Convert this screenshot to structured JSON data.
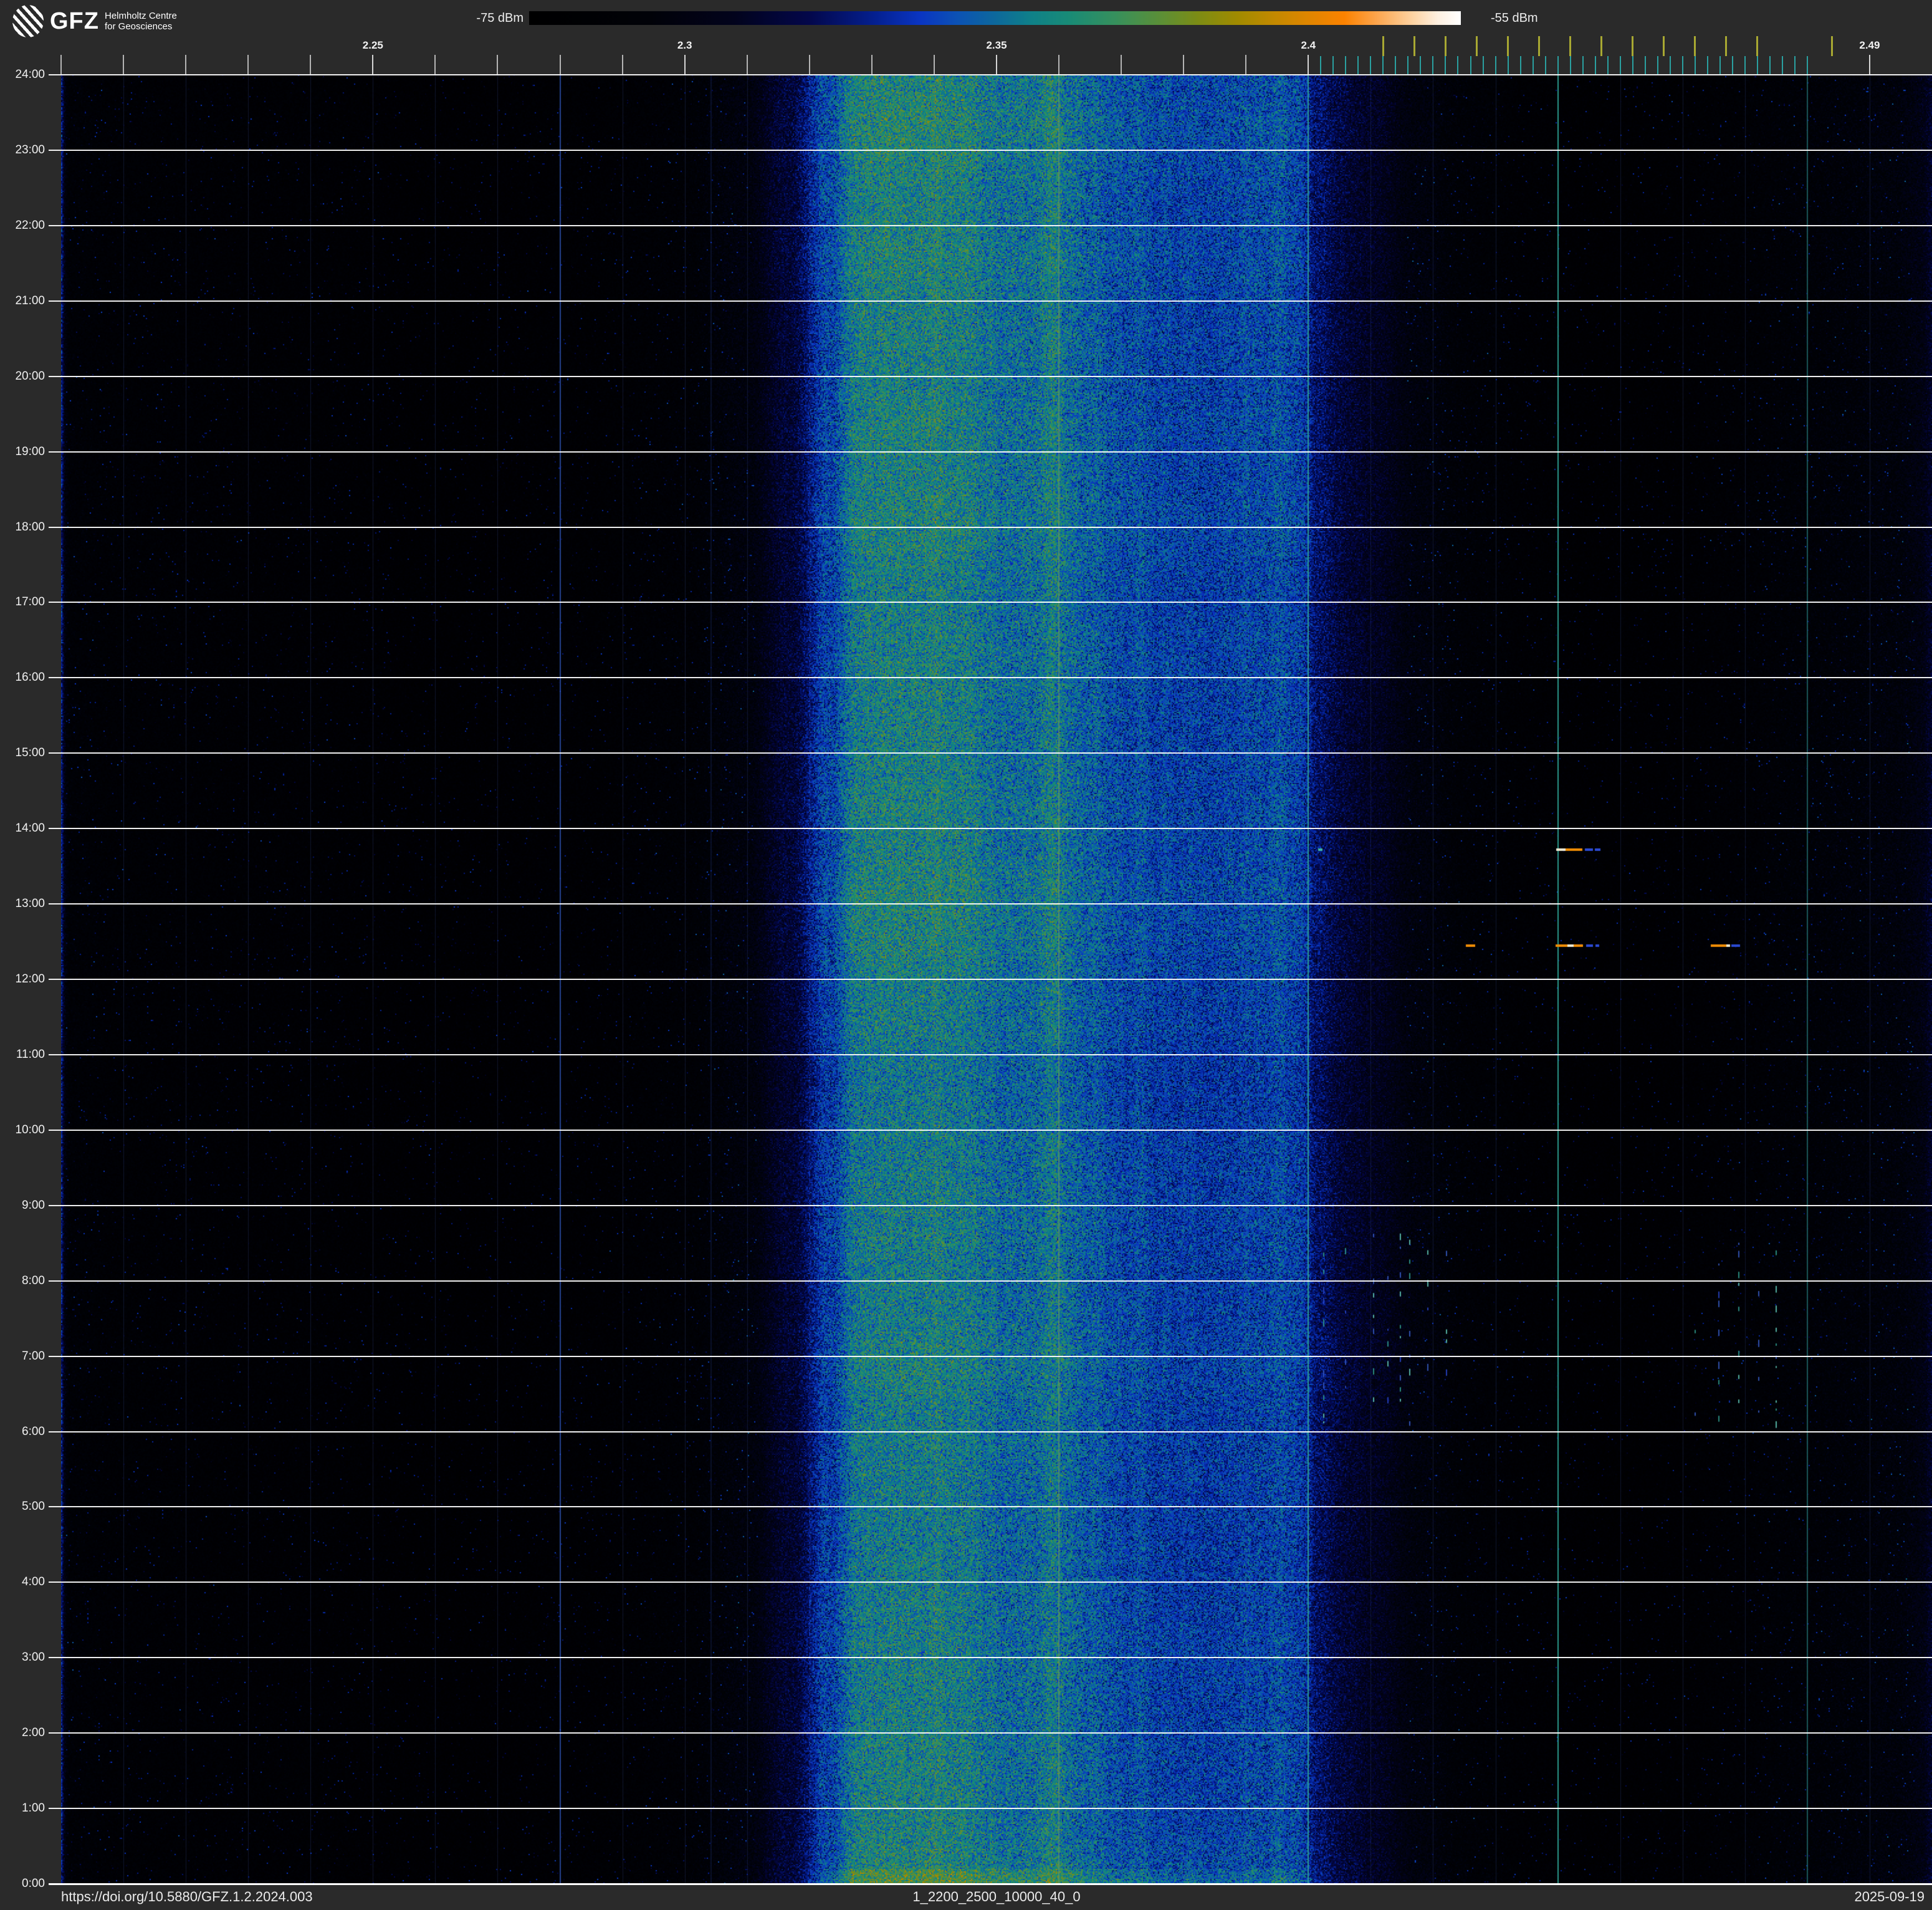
{
  "background": "#2a2a2a",
  "header": {
    "logo": {
      "brand": "GFZ",
      "line1": "Helmholtz Centre",
      "line2": "for Geosciences"
    },
    "colorbar": {
      "min_label": "-75 dBm",
      "max_label": "-55 dBm",
      "stops": [
        [
          0.0,
          "#000000"
        ],
        [
          0.13,
          "#010208"
        ],
        [
          0.22,
          "#02031c"
        ],
        [
          0.3,
          "#03074a"
        ],
        [
          0.37,
          "#041f8e"
        ],
        [
          0.42,
          "#0a35c2"
        ],
        [
          0.46,
          "#0c52b4"
        ],
        [
          0.5,
          "#0d689c"
        ],
        [
          0.54,
          "#0f8188"
        ],
        [
          0.58,
          "#198b76"
        ],
        [
          0.63,
          "#37905c"
        ],
        [
          0.68,
          "#5d8f35"
        ],
        [
          0.72,
          "#7e8c13"
        ],
        [
          0.76,
          "#a08a00"
        ],
        [
          0.8,
          "#c38900"
        ],
        [
          0.84,
          "#e28500"
        ],
        [
          0.875,
          "#fb8200"
        ],
        [
          0.91,
          "#fca54e"
        ],
        [
          0.945,
          "#fdcf9b"
        ],
        [
          0.975,
          "#fef0e0"
        ],
        [
          1.0,
          "#ffffff"
        ]
      ]
    }
  },
  "footer": {
    "doi": "https://doi.org/10.5880/GFZ.1.2.2024.003",
    "filename": "1_2200_2500_10000_40_0",
    "date": "2025-09-19"
  },
  "chart_data": {
    "type": "heatmap",
    "x_axis": {
      "unit": "GHz",
      "range": [
        2.2,
        2.5
      ],
      "tick_values": [
        2.25,
        2.3,
        2.35,
        2.4,
        2.49
      ],
      "tick_labels": [
        "2.25",
        "2.3",
        "2.35",
        "2.4",
        "2.49"
      ],
      "minor_tick_step": 0.01
    },
    "y_axis": {
      "unit": "time of day",
      "hour_labels": [
        "24:00",
        "23:00",
        "22:00",
        "21:00",
        "20:00",
        "19:00",
        "18:00",
        "17:00",
        "16:00",
        "15:00",
        "14:00",
        "13:00",
        "12:00",
        "11:00",
        "10:00",
        "9:00",
        "8:00",
        "7:00",
        "6:00",
        "5:00",
        "4:00",
        "3:00",
        "2:00",
        "1:00",
        "0:00"
      ]
    },
    "power_scale_dbm": [
      -75,
      -55
    ],
    "wifi_channel_ticks_mhz": [
      2412,
      2417,
      2422,
      2427,
      2432,
      2437,
      2442,
      2447,
      2452,
      2457,
      2462,
      2467,
      2472,
      2484
    ],
    "ble_channel_ticks_mhz": {
      "start": 2402,
      "end": 2480,
      "step": 2
    },
    "marker_lines": [
      {
        "ghz": 2.28,
        "color": "#3c6eeb",
        "alpha": 0.55,
        "w": 2
      },
      {
        "ghz": 2.3042,
        "color": "#3c6eeb",
        "alpha": 0.3,
        "w": 1
      },
      {
        "ghz": 2.36,
        "color": "#6e9b5a",
        "alpha": 0.6,
        "w": 2
      },
      {
        "ghz": 2.4,
        "color": "#2da596",
        "alpha": 0.9,
        "w": 2
      },
      {
        "ghz": 2.44,
        "color": "#2da596",
        "alpha": 0.9,
        "w": 2
      },
      {
        "ghz": 2.48,
        "color": "#2da094",
        "alpha": 0.5,
        "w": 2
      }
    ],
    "band_profile": [
      [
        2.2,
        0.105
      ],
      [
        2.21,
        0.085
      ],
      [
        2.235,
        0.075
      ],
      [
        2.262,
        0.062
      ],
      [
        2.285,
        0.072
      ],
      [
        2.3,
        0.095
      ],
      [
        2.31,
        0.15
      ],
      [
        2.317,
        0.26
      ],
      [
        2.323,
        0.43
      ],
      [
        2.328,
        0.545
      ],
      [
        2.334,
        0.58
      ],
      [
        2.341,
        0.575
      ],
      [
        2.347,
        0.55
      ],
      [
        2.3505,
        0.52
      ],
      [
        2.354,
        0.535
      ],
      [
        2.36,
        0.53
      ],
      [
        2.365,
        0.505
      ],
      [
        2.371,
        0.465
      ],
      [
        2.378,
        0.44
      ],
      [
        2.385,
        0.432
      ],
      [
        2.391,
        0.44
      ],
      [
        2.396,
        0.46
      ],
      [
        2.399,
        0.43
      ],
      [
        2.402,
        0.33
      ],
      [
        2.406,
        0.27
      ],
      [
        2.411,
        0.22
      ],
      [
        2.418,
        0.15
      ],
      [
        2.426,
        0.105
      ],
      [
        2.436,
        0.075
      ],
      [
        2.447,
        0.06
      ],
      [
        2.458,
        0.068
      ],
      [
        2.468,
        0.085
      ],
      [
        2.478,
        0.11
      ],
      [
        2.487,
        0.125
      ],
      [
        2.494,
        0.14
      ],
      [
        2.5,
        0.18
      ]
    ],
    "bursts": [
      {
        "time": "13:43",
        "segments": [
          [
            2401.6,
            2402.3,
            "teal"
          ],
          [
            2439.7,
            2441.2,
            "white"
          ],
          [
            2441.2,
            2443.9,
            "orange"
          ],
          [
            2444.3,
            2445.6,
            "blue"
          ],
          [
            2445.9,
            2446.8,
            "blue"
          ]
        ]
      },
      {
        "time": "12:27",
        "segments": [
          [
            2425.2,
            2426.7,
            "orange"
          ],
          [
            2439.6,
            2441.5,
            "orange"
          ],
          [
            2441.5,
            2442.5,
            "white"
          ],
          [
            2442.5,
            2444.0,
            "orange"
          ],
          [
            2444.5,
            2445.6,
            "blue"
          ],
          [
            2446.0,
            2446.6,
            "blue"
          ],
          [
            2464.5,
            2467.0,
            "orange"
          ],
          [
            2467.0,
            2467.6,
            "white"
          ],
          [
            2467.8,
            2469.2,
            "blue"
          ]
        ]
      }
    ],
    "streaks": {
      "time_start": "6:00",
      "time_end": "8:40",
      "groups": [
        {
          "channels_mhz": [
            2402.5,
            2406.0,
            2410.5,
            2412.8,
            2414.8,
            2416.3,
            2419.2,
            2422.2
          ],
          "density": 0.5
        },
        {
          "channels_mhz": [
            2462.0,
            2465.8,
            2469.0,
            2472.2,
            2475.0
          ],
          "density": 0.4
        }
      ]
    },
    "colors": {
      "minor_tick": "#b5b5b5",
      "labeled_tick": "#d5d5d5",
      "wifi_tick": "#a8a832",
      "ble_tick": "#2aa0a0",
      "faint_vline": "rgba(70,95,185,0.22)",
      "burst_white": "#efe9d2",
      "burst_orange": "#ef8c05",
      "burst_blue": "#2b4ad2",
      "burst_teal": "#3fb3a4"
    }
  }
}
